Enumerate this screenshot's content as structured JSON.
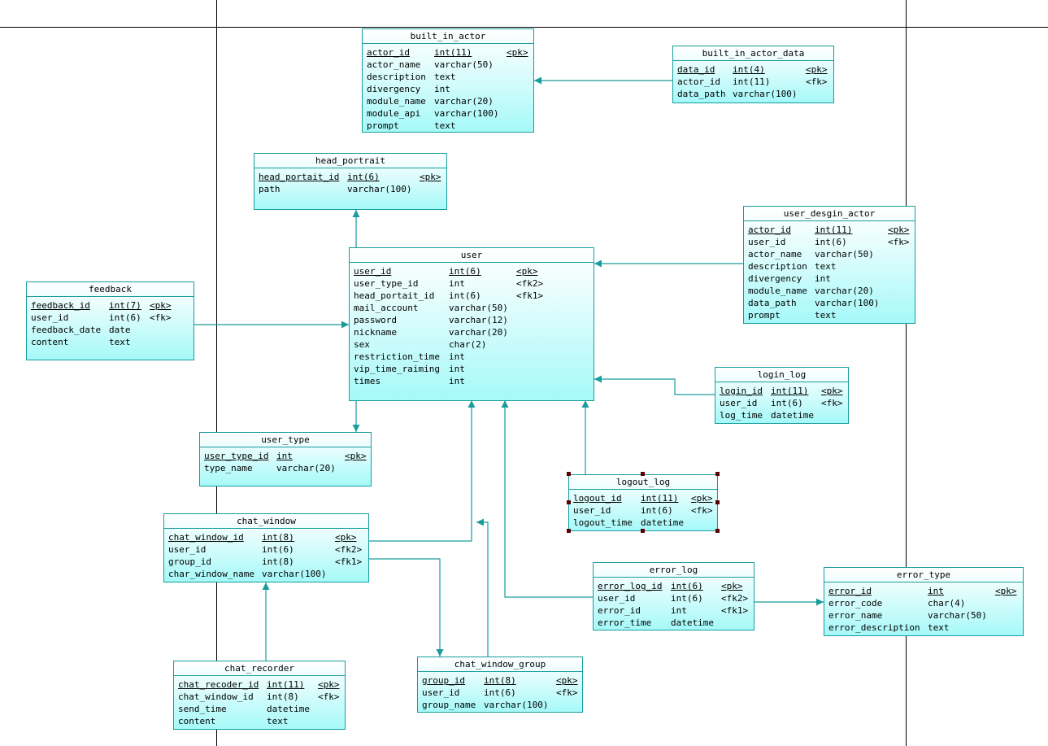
{
  "colors": {
    "line": "#199c9c",
    "border": "#199c9c",
    "fill_top": "#ffffff",
    "fill_bottom": "#a6f9f9",
    "handle": "#5a0000"
  },
  "entities": {
    "built_in_actor": {
      "title": "built_in_actor",
      "rows": [
        {
          "name": "actor_id",
          "type": "int(11)",
          "key": "<pk>"
        },
        {
          "name": "actor_name",
          "type": "varchar(50)",
          "key": ""
        },
        {
          "name": "description",
          "type": "text",
          "key": ""
        },
        {
          "name": "divergency",
          "type": "int",
          "key": ""
        },
        {
          "name": "module_name",
          "type": "varchar(20)",
          "key": ""
        },
        {
          "name": "module_api",
          "type": "varchar(100)",
          "key": ""
        },
        {
          "name": "prompt",
          "type": "text",
          "key": ""
        }
      ]
    },
    "built_in_actor_data": {
      "title": "built_in_actor_data",
      "rows": [
        {
          "name": "data_id",
          "type": "int(4)",
          "key": "<pk>"
        },
        {
          "name": "actor_id",
          "type": "int(11)",
          "key": "<fk>"
        },
        {
          "name": "data_path",
          "type": "varchar(100)",
          "key": ""
        }
      ]
    },
    "head_portrait": {
      "title": "head_portrait",
      "rows": [
        {
          "name": "head_portait_id",
          "type": "int(6)",
          "key": "<pk>"
        },
        {
          "name": "path",
          "type": "varchar(100)",
          "key": ""
        }
      ]
    },
    "user_desgin_actor": {
      "title": "user_desgin_actor",
      "rows": [
        {
          "name": "actor_id",
          "type": "int(11)",
          "key": "<pk>"
        },
        {
          "name": "user_id",
          "type": "int(6)",
          "key": "<fk>"
        },
        {
          "name": "actor_name",
          "type": "varchar(50)",
          "key": ""
        },
        {
          "name": "description",
          "type": "text",
          "key": ""
        },
        {
          "name": "divergency",
          "type": "int",
          "key": ""
        },
        {
          "name": "module_name",
          "type": "varchar(20)",
          "key": ""
        },
        {
          "name": "data_path",
          "type": "varchar(100)",
          "key": ""
        },
        {
          "name": "prompt",
          "type": "text",
          "key": ""
        }
      ]
    },
    "user": {
      "title": "user",
      "rows": [
        {
          "name": "user_id",
          "type": "int(6)",
          "key": "<pk>"
        },
        {
          "name": "user_type_id",
          "type": "int",
          "key": "<fk2>"
        },
        {
          "name": "head_portait_id",
          "type": "int(6)",
          "key": "<fk1>"
        },
        {
          "name": "mail_account",
          "type": "varchar(50)",
          "key": ""
        },
        {
          "name": "password",
          "type": "varchar(12)",
          "key": ""
        },
        {
          "name": "nickname",
          "type": "varchar(20)",
          "key": ""
        },
        {
          "name": "sex",
          "type": "char(2)",
          "key": ""
        },
        {
          "name": "restriction_time",
          "type": "int",
          "key": ""
        },
        {
          "name": "vip_time_raiming",
          "type": "int",
          "key": ""
        },
        {
          "name": "times",
          "type": "int",
          "key": ""
        }
      ]
    },
    "feedback": {
      "title": "feedback",
      "rows": [
        {
          "name": "feedback_id",
          "type": "int(7)",
          "key": "<pk>"
        },
        {
          "name": "user_id",
          "type": "int(6)",
          "key": "<fk>"
        },
        {
          "name": "feedback_date",
          "type": "date",
          "key": ""
        },
        {
          "name": "content",
          "type": "text",
          "key": ""
        }
      ]
    },
    "login_log": {
      "title": "login_log",
      "rows": [
        {
          "name": "login_id",
          "type": "int(11)",
          "key": "<pk>"
        },
        {
          "name": "user_id",
          "type": "int(6)",
          "key": "<fk>"
        },
        {
          "name": "log_time",
          "type": "datetime",
          "key": ""
        }
      ]
    },
    "user_type": {
      "title": "user_type",
      "rows": [
        {
          "name": "user_type_id",
          "type": "int",
          "key": "<pk>"
        },
        {
          "name": "type_name",
          "type": "varchar(20)",
          "key": ""
        }
      ]
    },
    "logout_log": {
      "title": "logout_log",
      "rows": [
        {
          "name": "logout_id",
          "type": "int(11)",
          "key": "<pk>"
        },
        {
          "name": "user_id",
          "type": "int(6)",
          "key": "<fk>"
        },
        {
          "name": "logout_time",
          "type": "datetime",
          "key": ""
        }
      ]
    },
    "chat_window": {
      "title": "chat_window",
      "rows": [
        {
          "name": "chat_window_id",
          "type": "int(8)",
          "key": "<pk>"
        },
        {
          "name": "user_id",
          "type": "int(6)",
          "key": "<fk2>"
        },
        {
          "name": "group_id",
          "type": "int(8)",
          "key": "<fk1>"
        },
        {
          "name": "char_window_name",
          "type": "varchar(100)",
          "key": ""
        }
      ]
    },
    "error_log": {
      "title": "error_log",
      "rows": [
        {
          "name": "error_log_id",
          "type": "int(6)",
          "key": "<pk>"
        },
        {
          "name": "user_id",
          "type": "int(6)",
          "key": "<fk2>"
        },
        {
          "name": "error_id",
          "type": "int",
          "key": "<fk1>"
        },
        {
          "name": "error_time",
          "type": "datetime",
          "key": ""
        }
      ]
    },
    "error_type": {
      "title": "error_type",
      "rows": [
        {
          "name": "error_id",
          "type": "int",
          "key": "<pk>"
        },
        {
          "name": "error_code",
          "type": "char(4)",
          "key": ""
        },
        {
          "name": "error_name",
          "type": "varchar(50)",
          "key": ""
        },
        {
          "name": "error_description",
          "type": "text",
          "key": ""
        }
      ]
    },
    "chat_recorder": {
      "title": "chat_recorder",
      "rows": [
        {
          "name": "chat_recoder_id",
          "type": "int(11)",
          "key": "<pk>"
        },
        {
          "name": "chat_window_id",
          "type": "int(8)",
          "key": "<fk>"
        },
        {
          "name": "send_time",
          "type": "datetime",
          "key": ""
        },
        {
          "name": "content",
          "type": "text",
          "key": ""
        }
      ]
    },
    "chat_window_group": {
      "title": "chat_window_group",
      "rows": [
        {
          "name": "group_id",
          "type": "int(8)",
          "key": "<pk>"
        },
        {
          "name": "user_id",
          "type": "int(6)",
          "key": "<fk>"
        },
        {
          "name": "group_name",
          "type": "varchar(100)",
          "key": ""
        }
      ]
    }
  }
}
